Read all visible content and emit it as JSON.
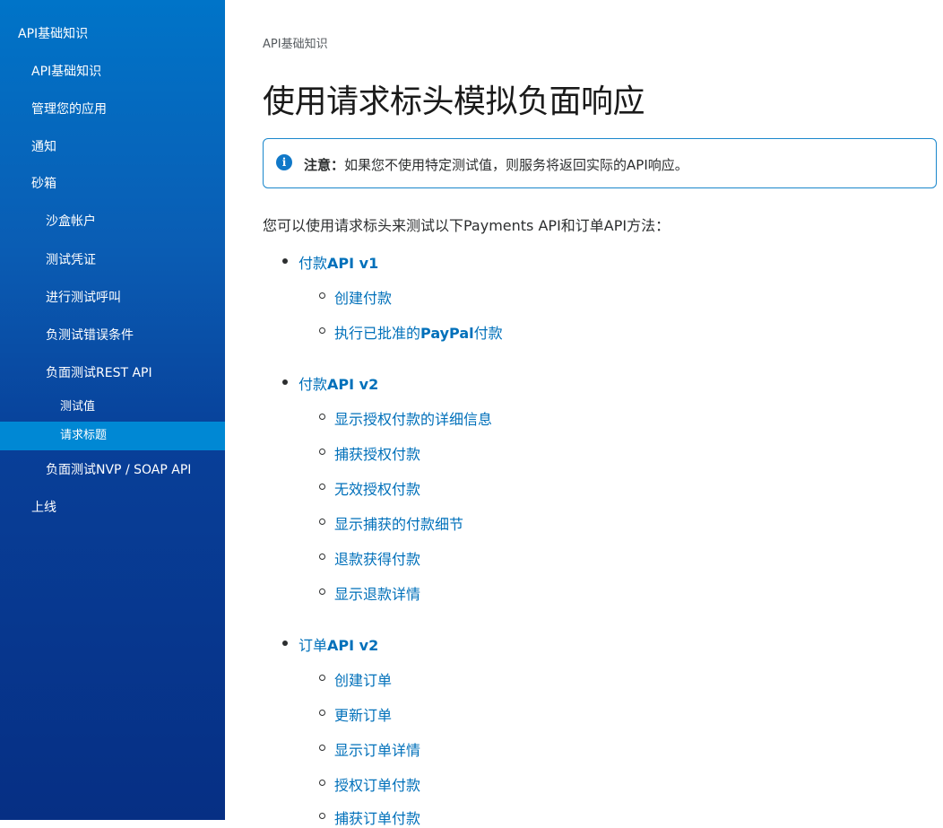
{
  "sidebar": {
    "items": [
      {
        "label": "API基础知识",
        "level": 0
      },
      {
        "label": "API基础知识",
        "level": 1
      },
      {
        "label": "管理您的应用",
        "level": 1
      },
      {
        "label": "通知",
        "level": 1
      },
      {
        "label": "砂箱",
        "level": 1
      },
      {
        "label": "沙盒帐户",
        "level": 2
      },
      {
        "label": "测试凭证",
        "level": 2
      },
      {
        "label": "进行测试呼叫",
        "level": 2
      },
      {
        "label": "负测试错误条件",
        "level": 2
      },
      {
        "label": "负面测试REST API",
        "level": 2
      },
      {
        "label": "测试值",
        "level": 3
      },
      {
        "label": "请求标题",
        "level": 3,
        "active": true
      },
      {
        "label": "负面测试NVP / SOAP API",
        "level": 2
      },
      {
        "label": "上线",
        "level": 1
      }
    ]
  },
  "main": {
    "breadcrumb": "API基础知识",
    "title": "使用请求标头模拟负面响应",
    "notice": {
      "icon": "info-icon",
      "icon_glyph": "i",
      "label": "注意：",
      "text": "如果您不使用特定测试值，则服务将返回实际的API响应。"
    },
    "intro": "您可以使用请求标头来测试以下Payments API和订单API方法：",
    "groups": [
      {
        "prefix": "付款",
        "strong": "API v1",
        "items": [
          {
            "text": "创建付款"
          },
          {
            "pre": "执行已批准的",
            "strong": "PayPal",
            "post": "付款"
          }
        ]
      },
      {
        "prefix": "付款",
        "strong": "API v2",
        "items": [
          {
            "text": "显示授权付款的详细信息"
          },
          {
            "text": "捕获授权付款"
          },
          {
            "text": "无效授权付款"
          },
          {
            "text": "显示捕获的付款细节"
          },
          {
            "text": "退款获得付款"
          },
          {
            "text": "显示退款详情"
          }
        ]
      },
      {
        "prefix": "订单",
        "strong": "API v2",
        "items": [
          {
            "text": "创建订单"
          },
          {
            "text": "更新订单"
          },
          {
            "text": "显示订单详情"
          },
          {
            "text": "授权订单付款"
          },
          {
            "text": "捕获订单付款"
          }
        ]
      }
    ]
  },
  "colors": {
    "link": "#0070ba",
    "sidebar_top": "#0074c8",
    "sidebar_bottom": "#062f84",
    "active_item": "#0088d4",
    "notice_border": "#1a87cc"
  }
}
